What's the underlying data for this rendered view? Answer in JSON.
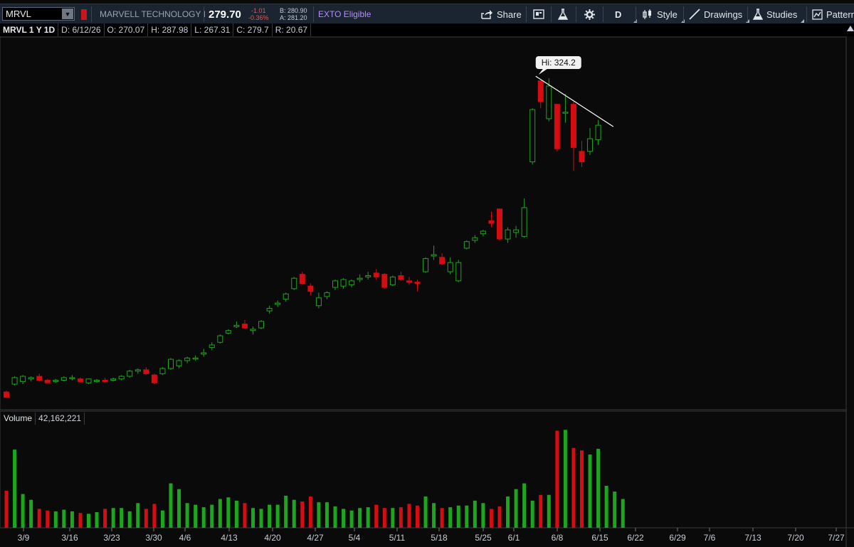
{
  "toolbar": {
    "symbol": "MRVL",
    "company": "MARVELL TECHNOLOGY I",
    "last_price": "279.70",
    "change": "-1.01",
    "change_pct": "-0.36%",
    "bid": "B: 280.90",
    "ask": "A: 281.20",
    "exto": "EXTO Eligible",
    "share": "Share",
    "period": "D",
    "style": "Style",
    "drawings": "Drawings",
    "studies": "Studies",
    "patterns": "Patterns"
  },
  "info_bar": {
    "title": "MRVL 1 Y 1D",
    "date": "D: 6/12/26",
    "open": "O: 270.07",
    "high": "H: 287.98",
    "low": "L: 267.31",
    "close": "C: 279.7",
    "range": "R: 20.67"
  },
  "volume_bar": {
    "label": "Volume",
    "value": "42,162,221"
  },
  "colors": {
    "up": "#1ea51e",
    "down": "#d40d12",
    "background": "#0a0a0a",
    "toolbar": "#1b2431"
  },
  "chart_data": {
    "type": "candlestick",
    "annotation": "Hi: 324.2",
    "x_tick_labels": [
      "3/9",
      "3/16",
      "3/23",
      "3/30",
      "4/6",
      "4/13",
      "4/20",
      "4/27",
      "5/4",
      "5/11",
      "5/18",
      "5/25",
      "6/1",
      "6/8",
      "6/15",
      "6/22",
      "6/29",
      "7/6",
      "7/13",
      "7/20",
      "7/27"
    ],
    "candles": [
      {
        "date": "3/6",
        "o": 86,
        "h": 87,
        "l": 82,
        "c": 82
      },
      {
        "date": "3/9",
        "o": 92,
        "h": 98,
        "l": 91,
        "c": 97
      },
      {
        "date": "3/10",
        "o": 94,
        "h": 99,
        "l": 92,
        "c": 98
      },
      {
        "date": "3/11",
        "o": 96,
        "h": 98,
        "l": 94,
        "c": 97
      },
      {
        "date": "3/12",
        "o": 98,
        "h": 100,
        "l": 94,
        "c": 95
      },
      {
        "date": "3/13",
        "o": 95,
        "h": 96,
        "l": 93,
        "c": 93
      },
      {
        "date": "3/16",
        "o": 94,
        "h": 96,
        "l": 93,
        "c": 95
      },
      {
        "date": "3/17",
        "o": 95,
        "h": 98,
        "l": 94,
        "c": 97
      },
      {
        "date": "3/18",
        "o": 97,
        "h": 99,
        "l": 95,
        "c": 97
      },
      {
        "date": "3/19",
        "o": 96,
        "h": 97,
        "l": 93,
        "c": 94
      },
      {
        "date": "3/20",
        "o": 93,
        "h": 96,
        "l": 92,
        "c": 96
      },
      {
        "date": "3/23",
        "o": 94,
        "h": 96,
        "l": 93,
        "c": 95
      },
      {
        "date": "3/24",
        "o": 95,
        "h": 97,
        "l": 93,
        "c": 94
      },
      {
        "date": "3/25",
        "o": 95,
        "h": 97,
        "l": 94,
        "c": 96
      },
      {
        "date": "3/26",
        "o": 96,
        "h": 99,
        "l": 95,
        "c": 98
      },
      {
        "date": "3/27",
        "o": 98,
        "h": 103,
        "l": 97,
        "c": 102
      },
      {
        "date": "3/30",
        "o": 102,
        "h": 104,
        "l": 100,
        "c": 103
      },
      {
        "date": "3/31",
        "o": 103,
        "h": 105,
        "l": 99,
        "c": 100
      },
      {
        "date": "4/1",
        "o": 99,
        "h": 100,
        "l": 92,
        "c": 93
      },
      {
        "date": "4/2",
        "o": 100,
        "h": 105,
        "l": 99,
        "c": 104
      },
      {
        "date": "4/3",
        "o": 104,
        "h": 112,
        "l": 103,
        "c": 111
      },
      {
        "date": "4/6",
        "o": 106,
        "h": 111,
        "l": 104,
        "c": 110
      },
      {
        "date": "4/7",
        "o": 110,
        "h": 113,
        "l": 108,
        "c": 112
      },
      {
        "date": "4/8",
        "o": 112,
        "h": 114,
        "l": 110,
        "c": 112
      },
      {
        "date": "4/9",
        "o": 115,
        "h": 119,
        "l": 113,
        "c": 116
      },
      {
        "date": "4/10",
        "o": 120,
        "h": 124,
        "l": 118,
        "c": 122
      },
      {
        "date": "4/13",
        "o": 124,
        "h": 130,
        "l": 123,
        "c": 129
      },
      {
        "date": "4/14",
        "o": 131,
        "h": 134,
        "l": 130,
        "c": 133
      },
      {
        "date": "4/15",
        "o": 136,
        "h": 140,
        "l": 135,
        "c": 137
      },
      {
        "date": "4/16",
        "o": 138,
        "h": 141,
        "l": 134,
        "c": 135
      },
      {
        "date": "4/17",
        "o": 133,
        "h": 136,
        "l": 130,
        "c": 134
      },
      {
        "date": "4/20",
        "o": 135,
        "h": 141,
        "l": 134,
        "c": 140
      },
      {
        "date": "4/21",
        "o": 148,
        "h": 152,
        "l": 146,
        "c": 150
      },
      {
        "date": "4/22",
        "o": 153,
        "h": 156,
        "l": 151,
        "c": 154
      },
      {
        "date": "4/23",
        "o": 157,
        "h": 162,
        "l": 155,
        "c": 161
      },
      {
        "date": "4/24",
        "o": 165,
        "h": 174,
        "l": 164,
        "c": 173
      },
      {
        "date": "4/27",
        "o": 176,
        "h": 178,
        "l": 168,
        "c": 169
      },
      {
        "date": "4/28",
        "o": 167,
        "h": 169,
        "l": 160,
        "c": 163
      },
      {
        "date": "4/29",
        "o": 152,
        "h": 162,
        "l": 150,
        "c": 158
      },
      {
        "date": "4/30",
        "o": 159,
        "h": 163,
        "l": 157,
        "c": 162
      },
      {
        "date": "5/1",
        "o": 166,
        "h": 172,
        "l": 164,
        "c": 171
      },
      {
        "date": "5/4",
        "o": 167,
        "h": 173,
        "l": 165,
        "c": 172
      },
      {
        "date": "5/5",
        "o": 168,
        "h": 172,
        "l": 166,
        "c": 171
      },
      {
        "date": "5/6",
        "o": 172,
        "h": 176,
        "l": 170,
        "c": 173
      },
      {
        "date": "5/7",
        "o": 174,
        "h": 178,
        "l": 172,
        "c": 175
      },
      {
        "date": "5/8",
        "o": 177,
        "h": 180,
        "l": 172,
        "c": 174
      },
      {
        "date": "5/11",
        "o": 176,
        "h": 177,
        "l": 165,
        "c": 166
      },
      {
        "date": "5/12",
        "o": 168,
        "h": 175,
        "l": 167,
        "c": 174
      },
      {
        "date": "5/13",
        "o": 175,
        "h": 178,
        "l": 171,
        "c": 172
      },
      {
        "date": "5/14",
        "o": 171,
        "h": 174,
        "l": 168,
        "c": 170
      },
      {
        "date": "5/15",
        "o": 170,
        "h": 172,
        "l": 163,
        "c": 169
      },
      {
        "date": "5/18",
        "o": 178,
        "h": 189,
        "l": 177,
        "c": 188
      },
      {
        "date": "5/19",
        "o": 190,
        "h": 198,
        "l": 187,
        "c": 191
      },
      {
        "date": "5/20",
        "o": 189,
        "h": 192,
        "l": 183,
        "c": 184
      },
      {
        "date": "5/21",
        "o": 178,
        "h": 189,
        "l": 176,
        "c": 185
      },
      {
        "date": "5/22",
        "o": 171,
        "h": 187,
        "l": 170,
        "c": 185
      },
      {
        "date": "5/25",
        "o": 196,
        "h": 202,
        "l": 195,
        "c": 201
      },
      {
        "date": "5/26",
        "o": 202,
        "h": 206,
        "l": 200,
        "c": 204
      },
      {
        "date": "5/27",
        "o": 207,
        "h": 210,
        "l": 205,
        "c": 209
      },
      {
        "date": "5/28",
        "o": 217,
        "h": 224,
        "l": 212,
        "c": 215
      },
      {
        "date": "5/29",
        "o": 226,
        "h": 226,
        "l": 202,
        "c": 203
      },
      {
        "date": "6/1",
        "o": 203,
        "h": 212,
        "l": 200,
        "c": 210
      },
      {
        "date": "6/2",
        "o": 208,
        "h": 213,
        "l": 204,
        "c": 210
      },
      {
        "date": "6/3",
        "o": 205,
        "h": 234,
        "l": 204,
        "c": 227
      },
      {
        "date": "6/4",
        "o": 262,
        "h": 303,
        "l": 260,
        "c": 302
      },
      {
        "date": "6/5",
        "o": 324,
        "h": 324,
        "l": 303,
        "c": 308
      },
      {
        "date": "6/6",
        "o": 295,
        "h": 326,
        "l": 293,
        "c": 320
      },
      {
        "date": "6/8",
        "o": 306,
        "h": 306,
        "l": 270,
        "c": 272
      },
      {
        "date": "6/9",
        "o": 300,
        "h": 314,
        "l": 292,
        "c": 300
      },
      {
        "date": "6/10",
        "o": 306,
        "h": 308,
        "l": 255,
        "c": 273
      },
      {
        "date": "6/11",
        "o": 270,
        "h": 278,
        "l": 258,
        "c": 262
      },
      {
        "date": "6/12",
        "o": 270.07,
        "h": 287.98,
        "l": 267.31,
        "c": 279.7
      },
      {
        "date": "6/15",
        "o": 279,
        "h": 294,
        "l": 275,
        "c": 290
      }
    ],
    "volume": [
      45,
      95,
      41,
      34,
      23,
      21,
      20,
      22,
      20,
      18,
      17,
      19,
      23,
      24,
      24,
      20,
      30,
      23,
      29,
      21,
      54,
      47,
      30,
      28,
      25,
      28,
      35,
      37,
      33,
      30,
      24,
      23,
      28,
      28,
      39,
      34,
      32,
      38,
      31,
      31,
      26,
      23,
      21,
      24,
      25,
      28,
      24,
      24,
      25,
      29,
      27,
      38,
      30,
      24,
      25,
      27,
      27,
      33,
      30,
      23,
      26,
      38,
      47,
      54,
      33,
      40,
      40,
      118,
      119,
      97,
      94,
      89,
      96,
      51,
      44,
      35
    ]
  }
}
